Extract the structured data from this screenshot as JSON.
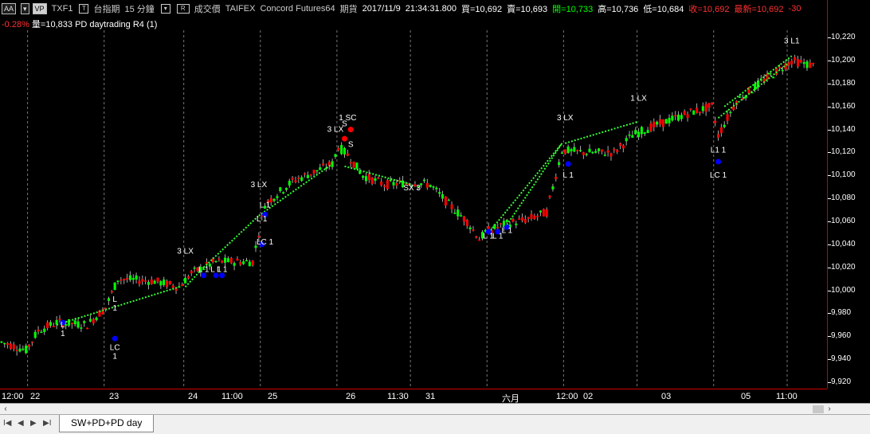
{
  "header": {
    "btn_aa": "AA",
    "btn_vp": "VP",
    "symbol": "TXF1",
    "sq1": "T",
    "name": "台指期",
    "interval": "15 分鐘",
    "sq2": "",
    "sq3": "R",
    "price_type": "成交價",
    "exchange": "TAIFEX",
    "feed": "Concord Futures64",
    "category": "期貨",
    "date": "2017/11/9",
    "time": "21:34:31.800",
    "bid": "買=10,692",
    "ask": "賣=10,693",
    "open": "開=10,733",
    "high": "高=10,736",
    "low": "低=10,684",
    "close": "收=10,692",
    "last": "最新=10,692",
    "change": "-30",
    "change_pct": "-0.28%",
    "volume": "量=10,833",
    "strategy": "PD daytrading R4 (1)"
  },
  "colors": {
    "up": "#00ff00",
    "down": "#ff0000",
    "open_color": "#00ff00",
    "close_color": "#ff0000",
    "entry_dot": "#0000ff",
    "exit_dot": "#ff0000",
    "trade_line": "#33ff33"
  },
  "price_axis": {
    "ticks": [
      "10,220",
      "10,200",
      "10,180",
      "10,160",
      "10,140",
      "10,120",
      "10,100",
      "10,080",
      "10,060",
      "10,040",
      "10,020",
      "10,000",
      "9,980",
      "9,960",
      "9,940",
      "9,920"
    ]
  },
  "time_axis": {
    "labels": [
      "12:00",
      "22",
      "23",
      "24",
      "11:00",
      "25",
      "26",
      "11:30",
      "31",
      "六月",
      "12:00",
      "02",
      "03",
      "05",
      "11:00"
    ]
  },
  "chart_data": {
    "type": "candlestick",
    "ylim": [
      9920,
      10225
    ],
    "price_ticks": [
      10220,
      10200,
      10180,
      10160,
      10140,
      10120,
      10100,
      10080,
      10060,
      10040,
      10020,
      10000,
      9980,
      9960,
      9940,
      9920
    ],
    "annotations": [
      {
        "text": "L",
        "sub": "1",
        "price": 9968,
        "bar": 20
      },
      {
        "text": "LC",
        "sub": "1",
        "price": 9948,
        "bar": 37
      },
      {
        "text": "L",
        "sub": "1",
        "price": 9990,
        "bar": 37
      },
      {
        "text": "3 LX",
        "price": 10032,
        "bar": 60
      },
      {
        "text": "L 1",
        "price": 10016,
        "bar": 66
      },
      {
        "text": "L 1",
        "price": 10016,
        "bar": 70
      },
      {
        "text": "L 1",
        "price": 10016,
        "bar": 72
      },
      {
        "text": "3 LX",
        "price": 10090,
        "bar": 84
      },
      {
        "text": "L 1",
        "price": 10072,
        "bar": 86
      },
      {
        "text": "L 1",
        "price": 10060,
        "bar": 85
      },
      {
        "text": "LC 1",
        "price": 10040,
        "bar": 86
      },
      {
        "text": "3 LX",
        "price": 10138,
        "bar": 109
      },
      {
        "text": "1 SC",
        "price": 10148,
        "bar": 113
      },
      {
        "text": "S",
        "price": 10143,
        "bar": 112
      },
      {
        "text": "S",
        "price": 10125,
        "bar": 114
      },
      {
        "text": "SX 3",
        "price": 10087,
        "bar": 134
      },
      {
        "text": "L 1",
        "price": 10045,
        "bar": 159
      },
      {
        "text": "L 1",
        "price": 10045,
        "bar": 162
      },
      {
        "text": "L 1",
        "price": 10050,
        "bar": 165
      },
      {
        "text": "3 LX",
        "price": 10148,
        "bar": 184
      },
      {
        "text": "L 1",
        "price": 10098,
        "bar": 185
      },
      {
        "text": "1 LX",
        "price": 10165,
        "bar": 208
      },
      {
        "text": "L1 1",
        "price": 10120,
        "bar": 234
      },
      {
        "text": "LC 1",
        "price": 10098,
        "bar": 234
      },
      {
        "text": "3 L1",
        "price": 10215,
        "bar": 258
      }
    ],
    "dot_labels": {
      "L": "L",
      "one": "1",
      "three": "3",
      "LX": "LX",
      "LC": "LC",
      "SC": "SC",
      "S": "S",
      "SX": "SX",
      "L1": "L1"
    },
    "day_separators_bar": [
      9,
      34,
      60,
      85,
      110,
      134,
      159,
      184,
      208,
      233,
      257
    ],
    "trades": [
      {
        "from_bar": 18,
        "from_price": 9970,
        "to_bar": 58,
        "to_price": 10003
      },
      {
        "from_bar": 60,
        "from_price": 10003,
        "to_bar": 66,
        "to_price": 10020
      },
      {
        "from_bar": 66,
        "from_price": 10020,
        "to_bar": 84,
        "to_price": 10065
      },
      {
        "from_bar": 84,
        "from_price": 10065,
        "to_bar": 108,
        "to_price": 10110
      },
      {
        "from_bar": 112,
        "from_price": 10108,
        "to_bar": 134,
        "to_price": 10092
      },
      {
        "from_bar": 159,
        "from_price": 10050,
        "to_bar": 183,
        "to_price": 10128
      },
      {
        "from_bar": 165,
        "from_price": 10057,
        "to_bar": 183,
        "to_price": 10128
      },
      {
        "from_bar": 184,
        "from_price": 10128,
        "to_bar": 208,
        "to_price": 10147
      },
      {
        "from_bar": 234,
        "from_price": 10150,
        "to_bar": 257,
        "to_price": 10198
      },
      {
        "from_bar": 236,
        "from_price": 10160,
        "to_bar": 258,
        "to_price": 10204
      }
    ]
  },
  "tabs": {
    "active": "SW+PD+PD day"
  },
  "nav": {
    "first": "I◀",
    "prev": "◀",
    "next": "▶",
    "last": "▶I"
  },
  "scroll": {
    "left": "‹",
    "right": "›"
  }
}
